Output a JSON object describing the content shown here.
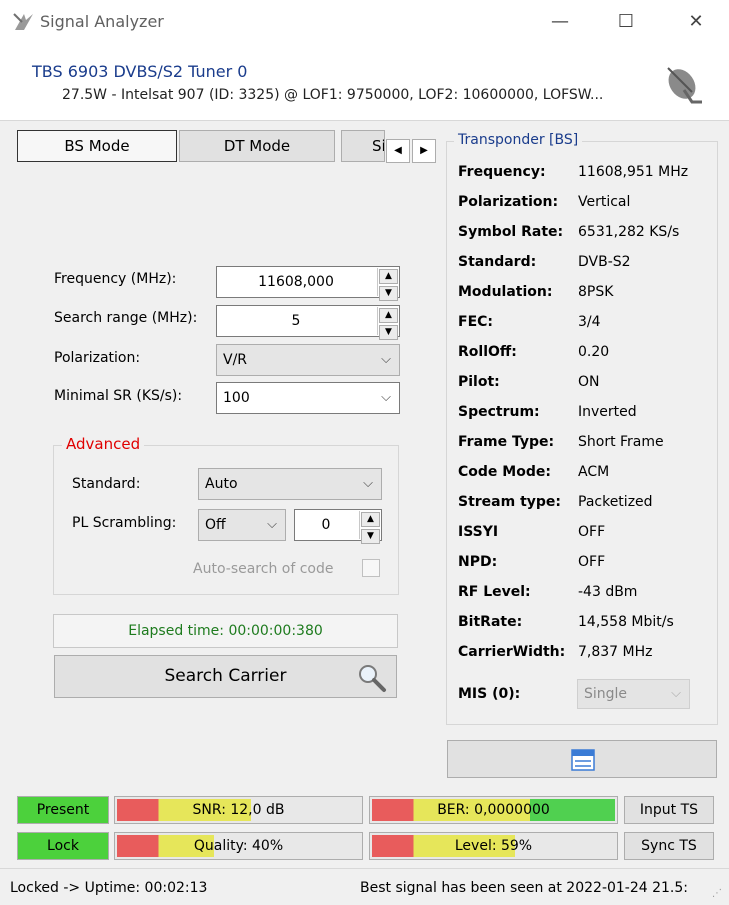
{
  "window": {
    "title": "Signal Analyzer",
    "minimize": "—",
    "maximize": "☐",
    "close": "✕"
  },
  "header": {
    "tuner": "TBS 6903 DVBS/S2 Tuner 0",
    "satellite": "27.5W - Intelsat 907 (ID: 3325) @ LOF1: 9750000, LOF2: 10600000, LOFSW..."
  },
  "tabs": [
    {
      "label": "BS Mode"
    },
    {
      "label": "DT Mode"
    },
    {
      "label": "Si"
    }
  ],
  "tab_arrows": {
    "left": "◀",
    "right": "▶"
  },
  "form": {
    "frequency_label": "Frequency (MHz):",
    "frequency_value": "11608,000",
    "search_range_label": "Search range (MHz):",
    "search_range_value": "5",
    "polarization_label": "Polarization:",
    "polarization_value": "V/R",
    "minimal_sr_label": "Minimal SR (KS/s):",
    "minimal_sr_value": "100",
    "spin_up": "▲",
    "spin_down": "▼",
    "dropdown_glyph": "⌵"
  },
  "advanced": {
    "title": "Advanced",
    "standard_label": "Standard:",
    "standard_value": "Auto",
    "pl_scrambling_label": "PL Scrambling:",
    "pl_scrambling_value": "Off",
    "pl_code_value": "0",
    "auto_search_label": "Auto-search of code"
  },
  "elapsed": "Elapsed time: 00:00:00:380",
  "search_button": "Search Carrier",
  "transponder": {
    "title": "Transponder [BS]",
    "rows": [
      {
        "label": "Frequency:",
        "value": "11608,951 MHz"
      },
      {
        "label": "Polarization:",
        "value": "Vertical"
      },
      {
        "label": "Symbol Rate:",
        "value": "6531,282 KS/s"
      },
      {
        "label": "Standard:",
        "value": "DVB-S2"
      },
      {
        "label": "Modulation:",
        "value": "8PSK"
      },
      {
        "label": "FEC:",
        "value": "3/4"
      },
      {
        "label": "RollOff:",
        "value": "0.20"
      },
      {
        "label": "Pilot:",
        "value": "ON"
      },
      {
        "label": "Spectrum:",
        "value": "Inverted"
      },
      {
        "label": "Frame Type:",
        "value": "Short Frame"
      },
      {
        "label": "Code Mode:",
        "value": "ACM"
      },
      {
        "label": "Stream type:",
        "value": "Packetized"
      },
      {
        "label": "ISSYI",
        "value": "OFF"
      },
      {
        "label": "NPD:",
        "value": "OFF"
      },
      {
        "label": "RF Level:",
        "value": "-43 dBm"
      },
      {
        "label": "BitRate:",
        "value": "14,558 Mbit/s"
      },
      {
        "label": "CarrierWidth:",
        "value": "7,837 MHz"
      }
    ],
    "mis_label": "MIS (0):",
    "mis_value": "Single"
  },
  "status": {
    "present": "Present",
    "lock": "Lock",
    "snr": "SNR: 12,0 dB",
    "snr_fill": 0.55,
    "ber": "BER: 0,0000000",
    "ber_fill": 1.0,
    "quality": "Quality: 40%",
    "quality_fill": 0.4,
    "level": "Level: 59%",
    "level_fill": 0.59,
    "input_ts": "Input TS",
    "sync_ts": "Sync TS"
  },
  "colors": {
    "ok_green": "#4cd13c",
    "meter_red": "#e85c5c",
    "meter_yellow": "#e6e65a",
    "meter_green": "#50d050",
    "accent_blue": "#1a3c8c",
    "advanced_red": "#e00000"
  },
  "statusbar": {
    "left": "Locked -> Uptime: 00:02:13",
    "right": "Best signal has been seen at 2022-01-24 21.5:"
  }
}
